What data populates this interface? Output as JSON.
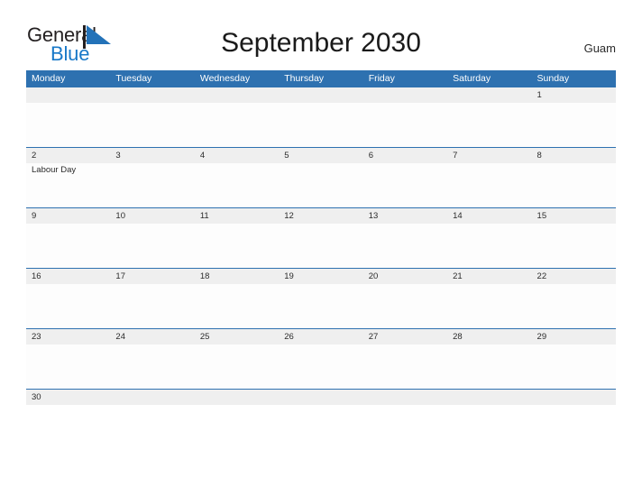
{
  "logo": {
    "word_one": "General",
    "word_two": "Blue",
    "flag_icon": "triangle-flag-icon",
    "color_dark": "#231f20",
    "color_blue": "#1878c8"
  },
  "header": {
    "title": "September 2030",
    "location": "Guam"
  },
  "theme": {
    "header_blue": "#2e71b0",
    "band_grey": "#efefef",
    "cell_white": "#fdfdfd",
    "text_dark": "#2b2b2b"
  },
  "calendar": {
    "weekdays": [
      "Monday",
      "Tuesday",
      "Wednesday",
      "Thursday",
      "Friday",
      "Saturday",
      "Sunday"
    ],
    "weeks": [
      {
        "days": [
          {
            "date": "",
            "event": ""
          },
          {
            "date": "",
            "event": ""
          },
          {
            "date": "",
            "event": ""
          },
          {
            "date": "",
            "event": ""
          },
          {
            "date": "",
            "event": ""
          },
          {
            "date": "",
            "event": ""
          },
          {
            "date": "1",
            "event": ""
          }
        ]
      },
      {
        "days": [
          {
            "date": "2",
            "event": "Labour Day"
          },
          {
            "date": "3",
            "event": ""
          },
          {
            "date": "4",
            "event": ""
          },
          {
            "date": "5",
            "event": ""
          },
          {
            "date": "6",
            "event": ""
          },
          {
            "date": "7",
            "event": ""
          },
          {
            "date": "8",
            "event": ""
          }
        ]
      },
      {
        "days": [
          {
            "date": "9",
            "event": ""
          },
          {
            "date": "10",
            "event": ""
          },
          {
            "date": "11",
            "event": ""
          },
          {
            "date": "12",
            "event": ""
          },
          {
            "date": "13",
            "event": ""
          },
          {
            "date": "14",
            "event": ""
          },
          {
            "date": "15",
            "event": ""
          }
        ]
      },
      {
        "days": [
          {
            "date": "16",
            "event": ""
          },
          {
            "date": "17",
            "event": ""
          },
          {
            "date": "18",
            "event": ""
          },
          {
            "date": "19",
            "event": ""
          },
          {
            "date": "20",
            "event": ""
          },
          {
            "date": "21",
            "event": ""
          },
          {
            "date": "22",
            "event": ""
          }
        ]
      },
      {
        "days": [
          {
            "date": "23",
            "event": ""
          },
          {
            "date": "24",
            "event": ""
          },
          {
            "date": "25",
            "event": ""
          },
          {
            "date": "26",
            "event": ""
          },
          {
            "date": "27",
            "event": ""
          },
          {
            "date": "28",
            "event": ""
          },
          {
            "date": "29",
            "event": ""
          }
        ]
      },
      {
        "days": [
          {
            "date": "30",
            "event": ""
          },
          {
            "date": "",
            "event": ""
          },
          {
            "date": "",
            "event": ""
          },
          {
            "date": "",
            "event": ""
          },
          {
            "date": "",
            "event": ""
          },
          {
            "date": "",
            "event": ""
          },
          {
            "date": "",
            "event": ""
          }
        ]
      }
    ]
  }
}
